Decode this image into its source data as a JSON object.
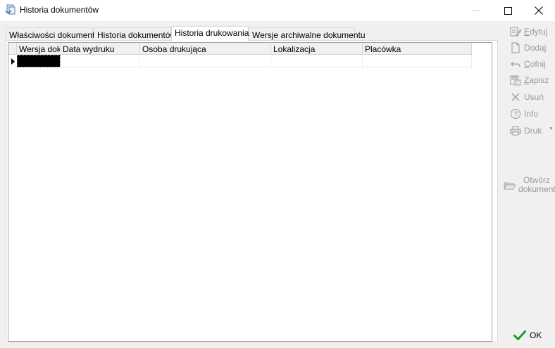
{
  "window": {
    "title": "Historia dokumentów"
  },
  "tabs": [
    {
      "label": "Właściwości dokumentu",
      "active": false
    },
    {
      "label": "Historia dokumentów",
      "active": false
    },
    {
      "label": "Historia drukowania",
      "active": true
    },
    {
      "label": "Wersje archiwalne dokumentu",
      "active": false
    }
  ],
  "grid": {
    "columns": [
      "Wersja dok.",
      "Data wydruku",
      "Osoba drukująca",
      "Lokalizacja",
      "Placówka"
    ],
    "rows": [
      [
        "",
        "",
        "",
        "",
        ""
      ]
    ]
  },
  "toolbar": {
    "edit": {
      "label": "Edytuj",
      "icon": "edit-icon"
    },
    "add": {
      "label": "Dodaj",
      "icon": "new-document-icon"
    },
    "undo": {
      "label": "Cofnij",
      "icon": "undo-icon"
    },
    "save": {
      "label": "Zapisz",
      "icon": "save-icon"
    },
    "delete": {
      "label": "Usuń",
      "icon": "delete-icon"
    },
    "info": {
      "label": "Info",
      "icon": "info-icon"
    },
    "print": {
      "label": "Druk",
      "icon": "printer-icon"
    },
    "open_line1": "Otwórz",
    "open_line2": "dokument",
    "ok": {
      "label": "OK",
      "icon": "check-icon"
    }
  },
  "colors": {
    "disabled_text": "#9a9a9a",
    "ok_check": "#1a9a2a"
  }
}
